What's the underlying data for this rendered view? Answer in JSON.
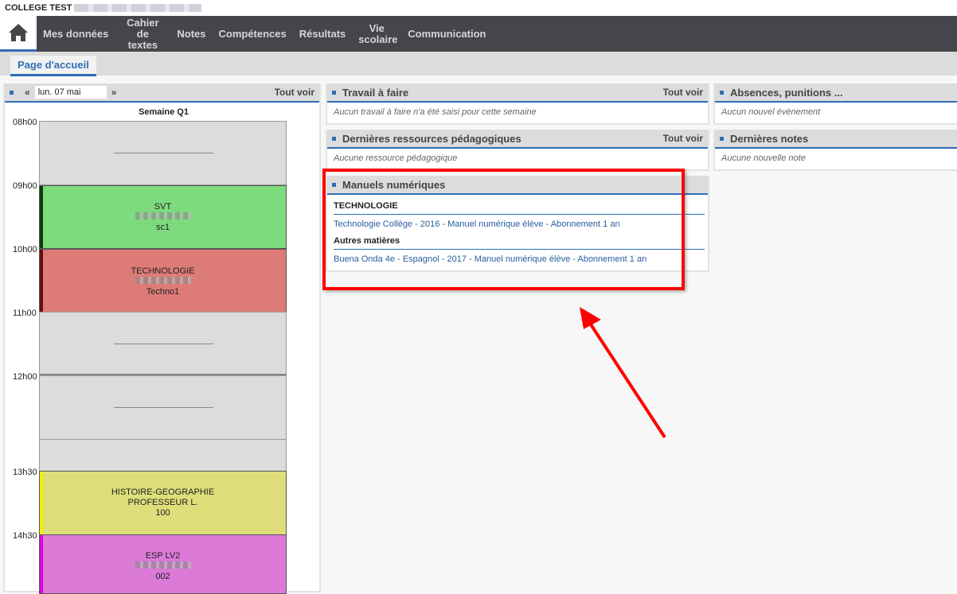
{
  "school": "COLLEGE TEST",
  "nav": {
    "items": [
      "Mes données",
      "Cahier de textes",
      "Notes",
      "Compétences",
      "Résultats",
      "Vie scolaire",
      "Communication"
    ]
  },
  "subtab": "Page d'accueil",
  "agenda": {
    "date": "lun. 07 mai",
    "see_all": "Tout voir",
    "week": "Semaine Q1",
    "times": [
      "08h00",
      "09h00",
      "10h00",
      "11h00",
      "12h00",
      "13h30",
      "14h30"
    ],
    "events": [
      {
        "subject": "SVT",
        "room": "sc1",
        "color": "#7ddb7d",
        "bar": "#0b3d0b"
      },
      {
        "subject": "TECHNOLOGIE",
        "room": "Techno1",
        "color": "#dd7b78",
        "bar": "#6b0d0d"
      },
      {
        "subject": "HISTOIRE-GEOGRAPHIE",
        "teacher": "PROFESSEUR L.",
        "room": "100",
        "color": "#dede7a",
        "bar": "#f0f000"
      },
      {
        "subject": "ESP LV2",
        "room": "002",
        "color": "#dc7ad8",
        "bar": "#e000e0"
      }
    ]
  },
  "travail": {
    "title": "Travail à faire",
    "see_all": "Tout voir",
    "empty": "Aucun travail à faire n'a été saisi pour cette semaine"
  },
  "ressources": {
    "title": "Dernières ressources pédagogiques",
    "see_all": "Tout voir",
    "empty": "Aucune ressource pédagogique"
  },
  "absences": {
    "title": "Absences, punitions ...",
    "empty": "Aucun nouvel évènement"
  },
  "notes": {
    "title": "Dernières notes",
    "empty": "Aucune nouvelle note"
  },
  "manuels": {
    "title": "Manuels numériques",
    "groups": [
      {
        "name": "TECHNOLOGIE",
        "items": [
          "Technologie Collège - 2016 - Manuel numérique élève - Abonnement 1 an"
        ]
      },
      {
        "name": "Autres matières",
        "items": [
          "Buena Onda 4e - Espagnol - 2017 - Manuel numérique élève - Abonnement 1 an"
        ]
      }
    ]
  },
  "colors": {
    "accent": "#2f6db5",
    "nav_bg": "#45464b",
    "highlight": "#ff0000"
  }
}
